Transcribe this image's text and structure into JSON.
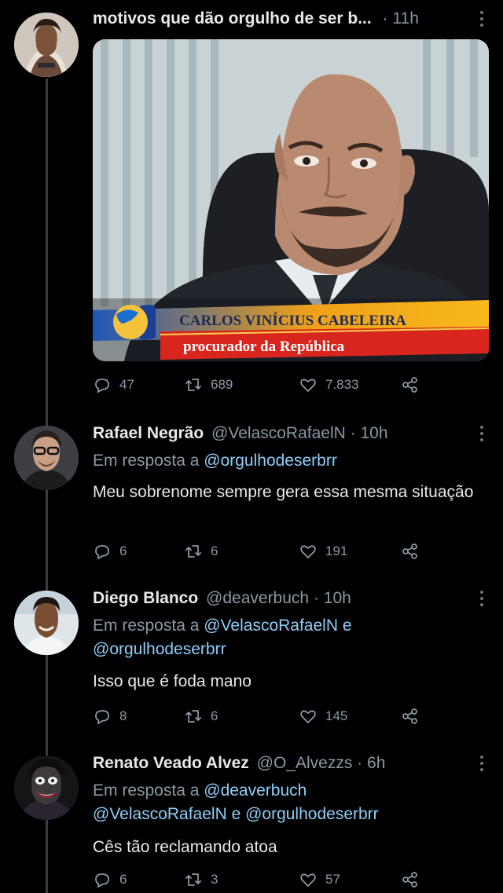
{
  "main_tweet": {
    "title": "motivos que dão orgulho de ser b...",
    "time": "11h",
    "image": {
      "caption_name": "CARLOS VINÍCIUS CABELEIRA",
      "caption_role": "procurador da República"
    },
    "replies": "47",
    "retweets": "689",
    "likes": "7.833"
  },
  "replies": [
    {
      "name": "Rafael Negrão",
      "handle": "@VelascoRafaelN",
      "time": "10h",
      "replying_prefix": "Em resposta a",
      "replying_links": "@orgulhodeserbrr",
      "text": "Meu sobrenome sempre gera essa mesma situação",
      "replies": "6",
      "retweets": "6",
      "likes": "191"
    },
    {
      "name": "Diego Blanco",
      "handle": "@deaverbuch",
      "time": "10h",
      "replying_prefix": "Em resposta a",
      "replying_links": "@VelascoRafaelN e @orgulhodeserbrr",
      "text": "Isso que é foda mano",
      "replies": "8",
      "retweets": "6",
      "likes": "145"
    },
    {
      "name": "Renato Veado Alvez",
      "handle": "@O_Alvezzs",
      "time": "6h",
      "replying_prefix": "Em resposta a",
      "replying_links": "@deaverbuch @VelascoRafaelN e @orgulhodeserbrr",
      "text": "Cês tão reclamando atoa",
      "replies": "6",
      "retweets": "3",
      "likes": "57"
    }
  ],
  "separator": "·",
  "colors": {
    "background": "#000000",
    "text": "#e7e9ea",
    "muted": "#8b98a5",
    "link": "#8ecdf8",
    "thread_line": "#3a3d41"
  }
}
